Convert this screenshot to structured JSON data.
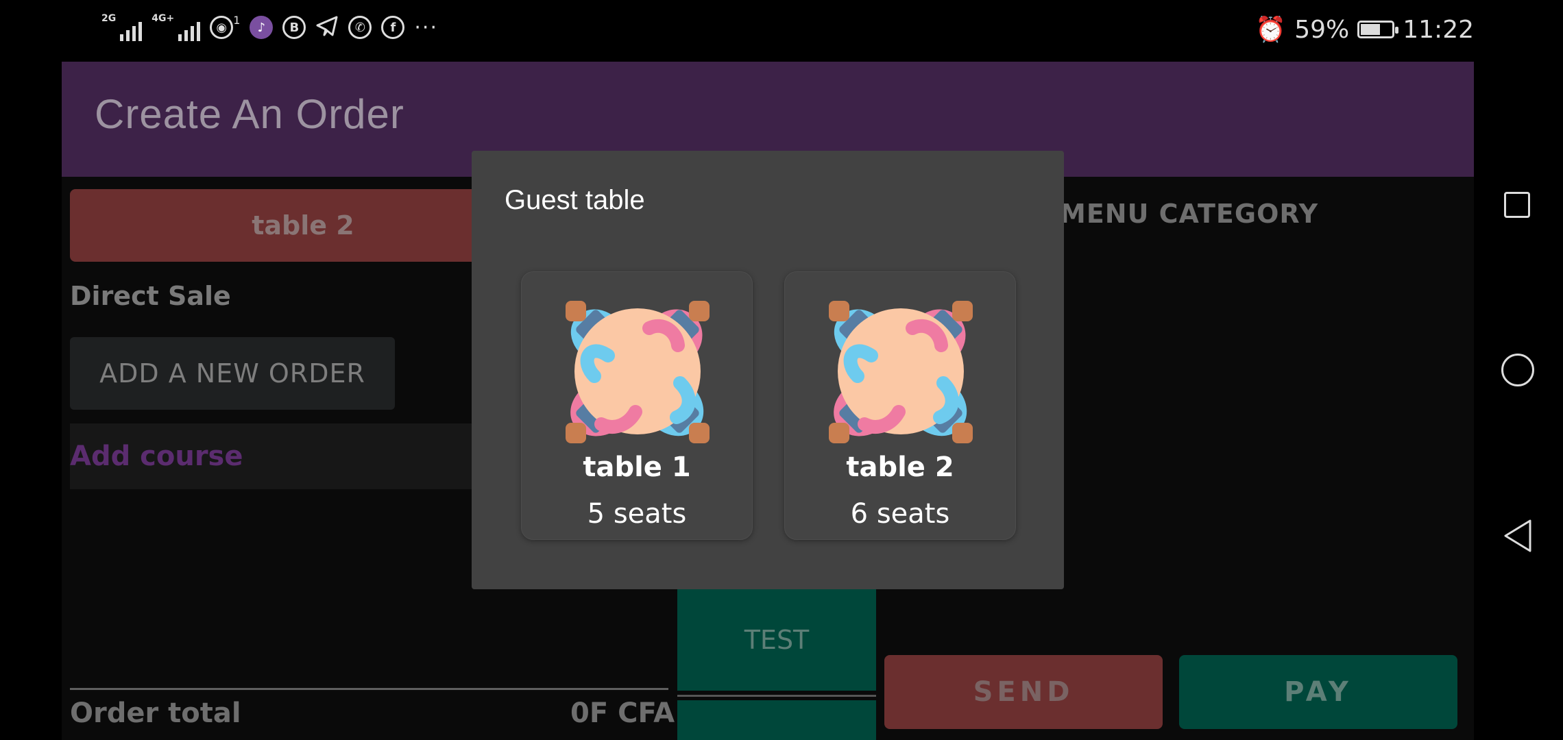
{
  "status_bar": {
    "net1": "2G",
    "net2": "4G+",
    "wifi_badge": "1",
    "more": "···",
    "battery_pct": "59%",
    "time": "11:22",
    "notification_icons": [
      "hotspot-icon",
      "music-icon",
      "business-icon",
      "telegram-icon",
      "whatsapp-icon",
      "facebook-icon"
    ]
  },
  "app": {
    "title": "Create An Order",
    "selected_table": "table 2",
    "direct_sale": "Direct Sale",
    "add_order": "ADD A NEW ORDER",
    "add_course": "Add course",
    "order_total_label": "Order total",
    "order_total_value": "0F CFA",
    "menu_category": "MENU CATEGORY",
    "test_item": "TEST",
    "send": "SEND",
    "pay": "PAY",
    "colors": {
      "appbar": "#3d2248",
      "accent_red": "#6b2f2f",
      "accent_green": "#00473a",
      "course_purple": "#5b2c6f"
    }
  },
  "dialog": {
    "title": "Guest table",
    "tables": [
      {
        "name": "table 1",
        "seats": "5 seats"
      },
      {
        "name": "table 2",
        "seats": "6 seats"
      }
    ]
  }
}
